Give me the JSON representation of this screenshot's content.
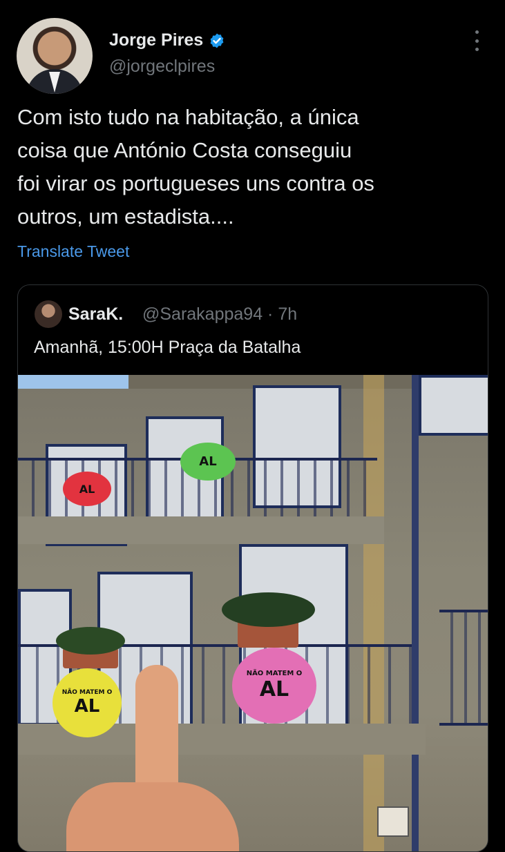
{
  "author": {
    "name": "Jorge Pires",
    "handle": "@jorgeclpires",
    "verified": true,
    "avatar_icon": "profile-photo"
  },
  "tweet": {
    "text": "Com isto tudo na habitação, a única\ncoisa que António Costa conseguiu\nfoi virar os portugueses uns contra os\noutros, um estadista....",
    "translate_label": "Translate Tweet"
  },
  "quote": {
    "name": "SaraK.",
    "handle": "@Sarakappa94 · 7h",
    "text": "Amanhã, 15:00H Praça da Batalha",
    "photo": {
      "sticker_texts": [
        "AL",
        "AL",
        "AL",
        "AL"
      ],
      "sticker_caption": "NÃO MATEM O",
      "sticker_colors": [
        "#e2333f",
        "#5cc451",
        "#e8e03b",
        "#e36fb5"
      ]
    }
  },
  "colors": {
    "background": "#000000",
    "text": "#e7e9ea",
    "secondary": "#71767b",
    "link": "#4a99e9",
    "verified": "#1d9bf0"
  }
}
